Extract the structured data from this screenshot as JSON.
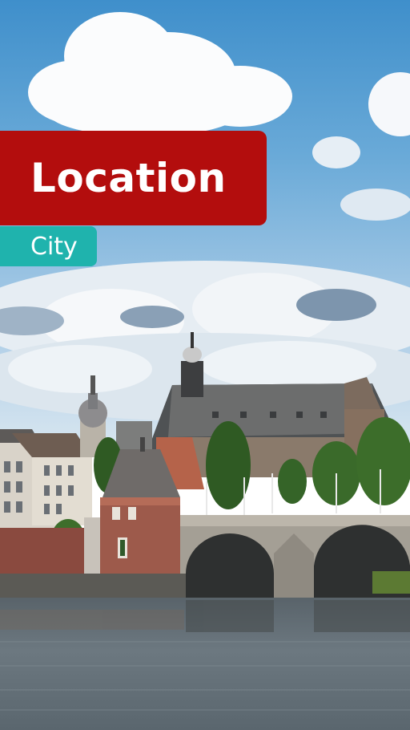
{
  "title": "Location",
  "subtitle": "City",
  "colors": {
    "title_bg": "#b30d0d",
    "subtitle_bg": "#1fb3ad",
    "text": "#ffffff"
  },
  "scene": {
    "description_icon": "city-river-bridge-photo"
  }
}
